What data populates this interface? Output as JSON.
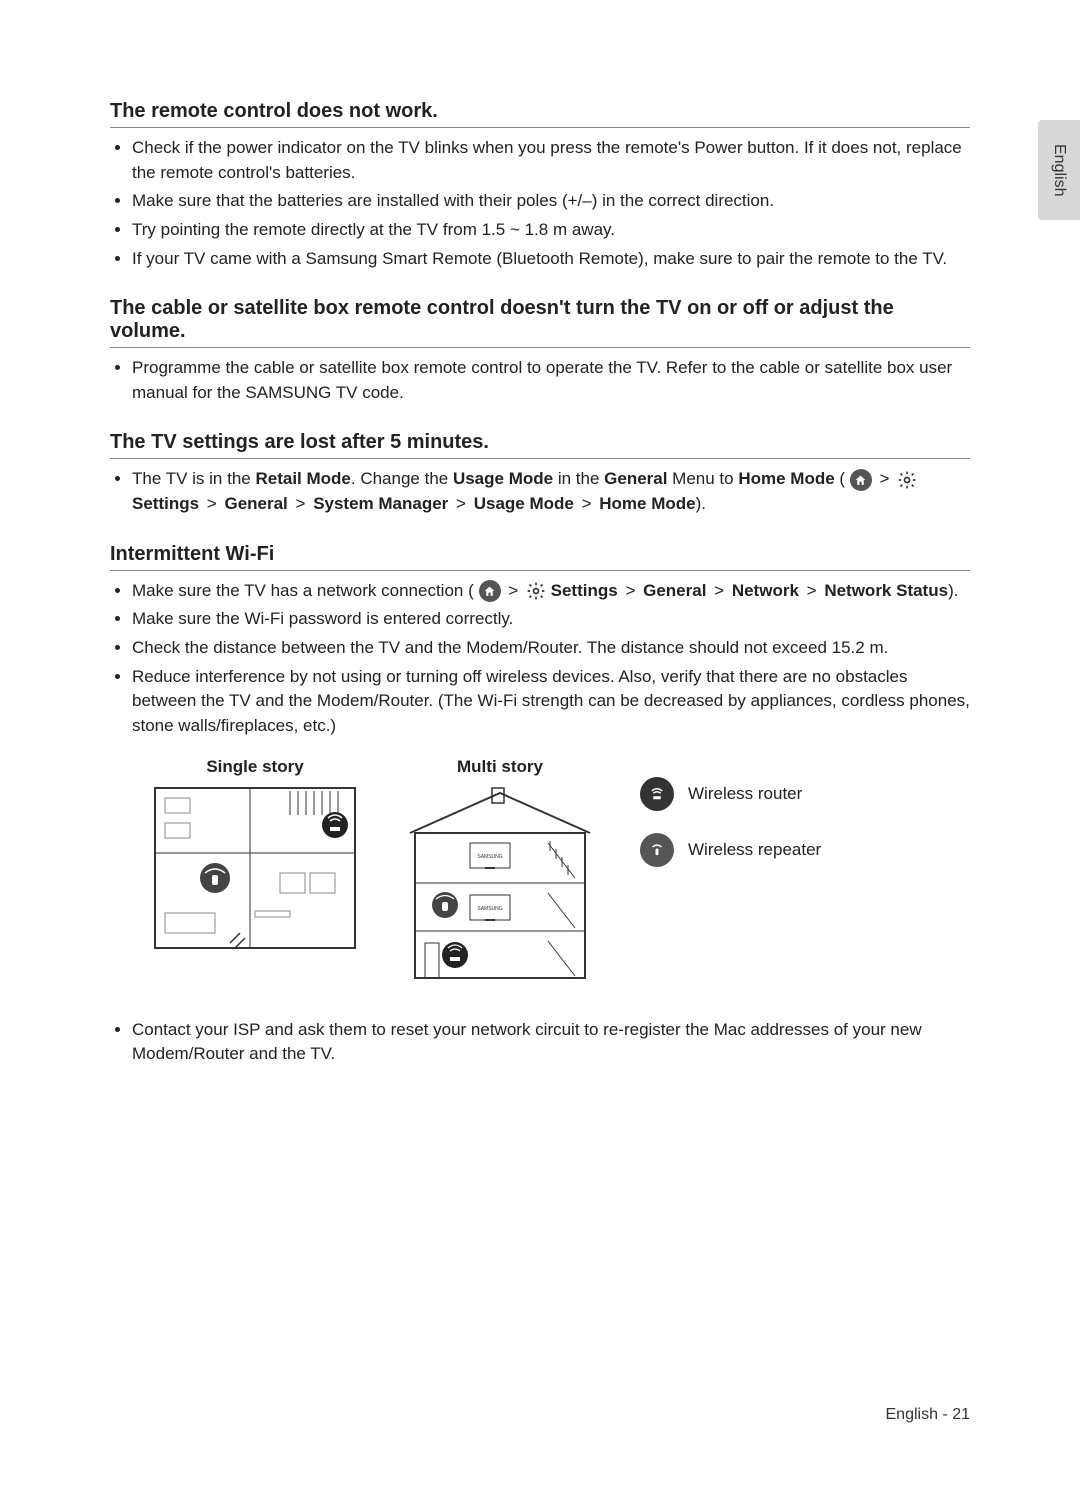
{
  "language_tab": "English",
  "page_footer": "English - 21",
  "sections": {
    "remote": {
      "heading": "The remote control does not work.",
      "bullets": [
        "Check if the power indicator on the TV blinks when you press the remote's Power button. If it does not, replace the remote control's batteries.",
        "Make sure that the batteries are installed with their poles (+/–) in the correct direction.",
        "Try pointing the remote directly at the TV from 1.5 ~ 1.8 m away.",
        "If your TV came with a Samsung Smart Remote (Bluetooth Remote), make sure to pair the remote to the TV."
      ]
    },
    "cable": {
      "heading": "The cable or satellite box remote control doesn't turn the TV on or off or adjust the volume.",
      "bullets": [
        "Programme the cable or satellite box remote control to operate the TV. Refer to the cable or satellite box user manual for the SAMSUNG TV code."
      ]
    },
    "settings_lost": {
      "heading": "The TV settings are lost after 5 minutes.",
      "text_pre": "The TV is in the ",
      "retail_mode": "Retail Mode",
      "text_mid1": ". Change the ",
      "usage_mode": "Usage Mode",
      "text_mid2": " in the ",
      "general": "General",
      "text_mid3": " Menu to ",
      "home_mode": "Home Mode",
      "path_settings": "Settings",
      "path_general": "General",
      "path_system_mgr": "System Manager",
      "path_usage_mode": "Usage Mode",
      "path_home_mode": "Home Mode"
    },
    "wifi": {
      "heading": "Intermittent Wi-Fi",
      "b1_pre": "Make sure the TV has a network connection (",
      "b1_settings": "Settings",
      "b1_general": "General",
      "b1_network": "Network",
      "b1_network_status": "Network Status",
      "b1_post": ").",
      "b2": "Make sure the Wi-Fi password is entered correctly.",
      "b3": "Check the distance between the TV and the Modem/Router. The distance should not exceed 15.2 m.",
      "b4": "Reduce interference by not using or turning off wireless devices. Also, verify that there are no obstacles between the TV and the Modem/Router. (The Wi-Fi strength can be decreased by appliances, cordless phones, stone walls/fireplaces, etc.)",
      "diagram1_title": "Single story",
      "diagram2_title": "Multi story",
      "legend_router": "Wireless router",
      "legend_repeater": "Wireless repeater",
      "b5": "Contact your ISP and ask them to reset your network circuit to re-register the Mac addresses of your new Modem/Router and the TV."
    }
  },
  "diagram_meta": {
    "samsung_label": "SAMSUNG"
  }
}
